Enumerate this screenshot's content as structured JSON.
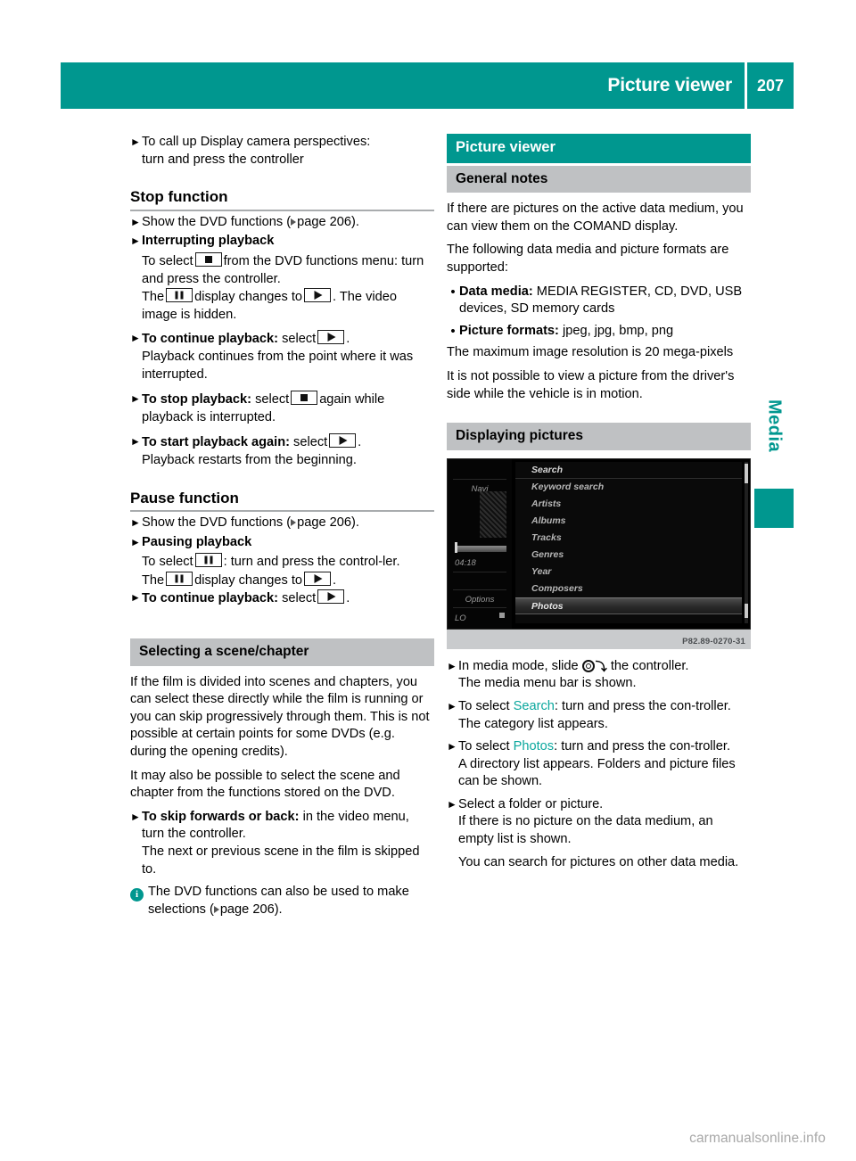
{
  "header": {
    "title": "Picture viewer",
    "page_number": "207"
  },
  "side_tab": {
    "label": "Media"
  },
  "footer": {
    "watermark": "carmanualsonline.info"
  },
  "left_column": {
    "intro_step": {
      "line1": "To call up Display camera perspectives:",
      "line2": "turn and press the controller"
    },
    "stop_function": {
      "heading": "Stop function",
      "step1_pre": "Show the DVD functions (",
      "step1_ref": "page 206",
      "step1_post": ").",
      "step2_bold": "Interrupting playback",
      "step2_body_a": "To select",
      "step2_body_b": "from the DVD functions menu: turn and press the controller.",
      "step2_body_c": "The",
      "step2_body_d": "display changes to",
      "step2_body_e": ". The video image is hidden.",
      "step3_bold": "To continue playback:",
      "step3_text": "select",
      "step3_after": ".",
      "step3_body": "Playback continues from the point where it was interrupted.",
      "step4_bold": "To stop playback:",
      "step4_text": "select",
      "step4_after": "again while",
      "step4_body": "playback is interrupted.",
      "step5_bold": "To start playback again:",
      "step5_text": "select",
      "step5_after": ".",
      "step5_body": "Playback restarts from the beginning."
    },
    "pause_function": {
      "heading": "Pause function",
      "step1_pre": "Show the DVD functions (",
      "step1_ref": "page 206",
      "step1_post": ").",
      "step2_bold": "Pausing playback",
      "step2_body_a": "To select",
      "step2_body_b": ": turn and press the control-ler.",
      "step2_body_c": "The",
      "step2_body_d": "display changes to",
      "step2_body_e": ".",
      "step3_bold": "To continue playback:",
      "step3_text": "select",
      "step3_after": "."
    },
    "scene_chapter": {
      "heading": "Selecting a scene/chapter",
      "para1": "If the film is divided into scenes and chapters, you can select these directly while the film is running or you can skip progressively through them. This is not possible at certain points for some DVDs (e.g. during the opening credits).",
      "para2": "It may also be possible to select the scene and chapter from the functions stored on the DVD.",
      "step1_bold": "To skip forwards or back:",
      "step1_text": "in the video menu, turn the controller.",
      "step1_body": "The next or previous scene in the film is skipped to.",
      "note_pre": "The DVD functions can also be used to make selections (",
      "note_ref": "page 206",
      "note_post": ")."
    }
  },
  "right_column": {
    "chapter_bar": "Picture viewer",
    "general_notes": {
      "heading": "General notes",
      "para1": "If there are pictures on the active data medium, you can view them on the COMAND display.",
      "para2": "The following data media and picture formats are supported:",
      "bullet1_bold": "Data media:",
      "bullet1_text": "MEDIA REGISTER, CD, DVD, USB devices, SD memory cards",
      "bullet2_bold": "Picture formats:",
      "bullet2_text": "jpeg, jpg, bmp, png",
      "para3": "The maximum image resolution is 20 mega-pixels",
      "para4": "It is not possible to view a picture from the driver's side while the vehicle is in motion."
    },
    "displaying_pictures": {
      "heading": "Displaying pictures",
      "figure": {
        "caption_code": "P82.89-0270-31",
        "left_panel": {
          "source_label": "Navi",
          "time": "04:18",
          "options_label": "Options",
          "status_label": "LO"
        },
        "menu_items": [
          "Search",
          "Keyword search",
          "Artists",
          "Albums",
          "Tracks",
          "Genres",
          "Year",
          "Composers",
          "Photos"
        ],
        "selected_item": "Photos"
      },
      "step1_pre": "In media mode, slide",
      "step1_post": "the controller.",
      "step1_body": "The media menu bar is shown.",
      "step2_pre": "To select",
      "step2_link": "Search",
      "step2_post": ": turn and press the con-troller.",
      "step2_body": "The category list appears.",
      "step3_pre": "To select",
      "step3_link": "Photos",
      "step3_post": ": turn and press the con-troller.",
      "step3_body": "A directory list appears. Folders and picture files can be shown.",
      "step4_text": "Select a folder or picture.",
      "step4_body1": "If there is no picture on the data medium, an empty list is shown.",
      "step4_body2": "You can search for pictures on other data media."
    }
  },
  "colors": {
    "brand_teal": "#00978f",
    "link_teal": "#0aa79d",
    "grey_bar": "#bfc1c3",
    "rule_grey": "#a9acae"
  }
}
